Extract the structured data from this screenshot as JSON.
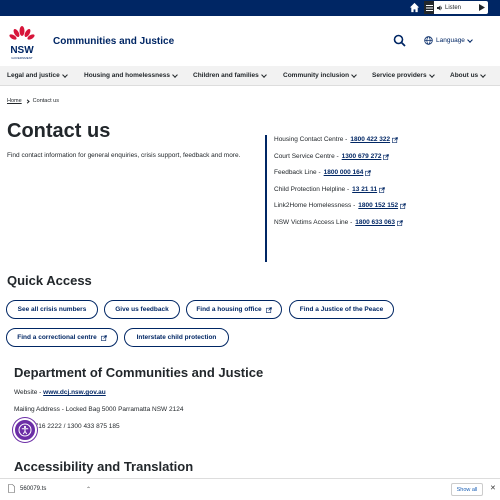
{
  "topbar": {
    "listen_label": "Listen"
  },
  "header": {
    "site_name": "Communities and Justice",
    "language_label": "Language",
    "logo_text": "NSW",
    "logo_sub": "GOVERNMENT"
  },
  "nav": {
    "items": [
      {
        "label": "Legal and justice"
      },
      {
        "label": "Housing and homelessness"
      },
      {
        "label": "Children and families"
      },
      {
        "label": "Community inclusion"
      },
      {
        "label": "Service providers"
      },
      {
        "label": "About us"
      }
    ]
  },
  "breadcrumb": {
    "home": "Home",
    "current": "Contact us"
  },
  "page": {
    "title": "Contact us",
    "intro": "Find contact information for general enquiries, crisis support, feedback and more."
  },
  "contacts": [
    {
      "label": "Housing Contact Centre -",
      "number": "1800 422 322"
    },
    {
      "label": "Court Service Centre -",
      "number": "1300 679 272"
    },
    {
      "label": "Feedback Line  -",
      "number": "1800 000 164"
    },
    {
      "label": "Child Protection Helpline -",
      "number": "13 21 11"
    },
    {
      "label": "Link2Home Homelessness -",
      "number": "1800 152 152"
    },
    {
      "label": "NSW Victims Access Line -",
      "number": "1800 633 063"
    }
  ],
  "quick_access": {
    "title": "Quick Access",
    "buttons": [
      {
        "label": "See all crisis numbers"
      },
      {
        "label": "Give us feedback"
      },
      {
        "label": "Find a housing office"
      },
      {
        "label": "Find a Justice of the Peace"
      },
      {
        "label": "Find a correctional centre"
      },
      {
        "label": "Interstate child protection"
      }
    ]
  },
  "department": {
    "title": "Department of Communities and Justice",
    "website_label": "Website -",
    "website_link": "www.dcj.nsw.gov.au",
    "mailing": "Mailing Address - Locked Bag 5000 Parramatta NSW 2124",
    "phone": "02 9716 2222 / 1300 433 875 185"
  },
  "accessibility": {
    "title": "Accessibility and Translation"
  },
  "downloads": {
    "file_name": "560079.ts",
    "show_all": "Show all"
  },
  "colors": {
    "brand": "#002664",
    "accessibility_widget": "#6b2ea6"
  }
}
